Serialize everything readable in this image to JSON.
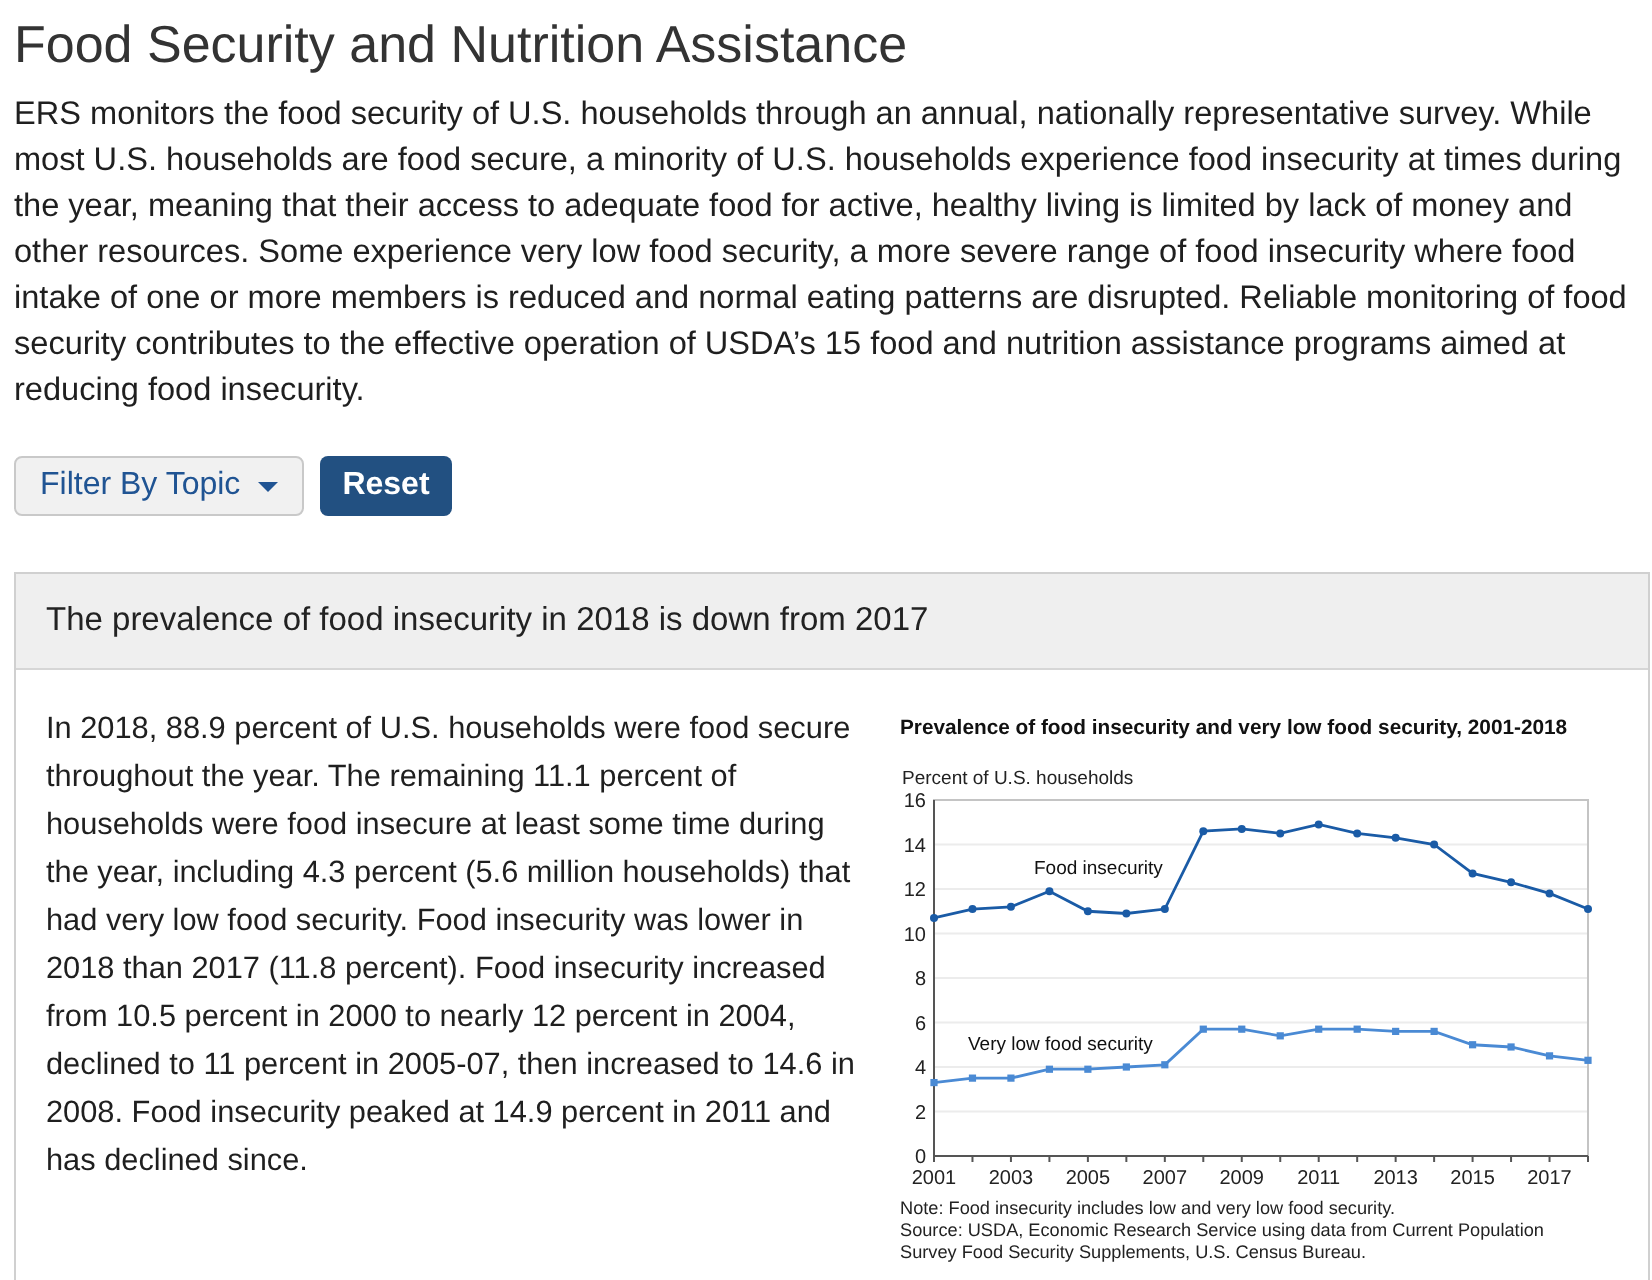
{
  "page": {
    "title": "Food Security and Nutrition Assistance",
    "intro": "ERS monitors the food security of U.S. households through an annual, nationally representative survey. While most U.S. households are food secure, a minority of U.S. households experience food insecurity at times during the year, meaning that their access to adequate food for active, healthy living is limited by lack of money and other resources. Some experience very low food security, a more severe range of food insecurity where food intake of one or more members is reduced and normal eating patterns are disrupted. Reliable monitoring of food security contributes to the effective operation of USDA’s 15 food and nutrition assistance programs aimed at reducing food insecurity."
  },
  "filters": [
    {
      "kind": "dropdown",
      "label": "Filter By Topic"
    },
    {
      "kind": "primary",
      "label": "Reset"
    }
  ],
  "card": {
    "heading": "The prevalence of food insecurity in 2018 is down from 2017",
    "body": "In 2018, 88.9 percent of U.S. households were food secure throughout the year. The remaining 11.1 percent of households were food insecure at least some time during the year, including 4.3 percent (5.6 million households) that had very low food security. Food insecurity was lower in 2018 than 2017 (11.8 percent). Food insecurity increased from 10.5 percent in 2000 to nearly 12 percent in 2004, declined to 11 percent in 2005-07, then increased to 14.6 in 2008. Food insecurity peaked at 14.9 percent in 2011 and has declined since.",
    "chart": {
      "chart_data": {
        "type": "line",
        "title": "Prevalence of food insecurity and very low food security, 2001-2018",
        "ylabel": "Percent of U.S. households",
        "x": [
          2001,
          2002,
          2003,
          2004,
          2005,
          2006,
          2007,
          2008,
          2009,
          2010,
          2011,
          2012,
          2013,
          2014,
          2015,
          2016,
          2017,
          2018
        ],
        "series": [
          {
            "name": "Food insecurity",
            "color": "#1a5ba6",
            "marker": "circle",
            "values": [
              10.7,
              11.1,
              11.2,
              11.9,
              11.0,
              10.9,
              11.1,
              14.6,
              14.7,
              14.5,
              14.9,
              14.5,
              14.3,
              14.0,
              12.7,
              12.3,
              11.8,
              11.1
            ]
          },
          {
            "name": "Very low food security",
            "color": "#4a8ad4",
            "marker": "square",
            "values": [
              3.3,
              3.5,
              3.5,
              3.9,
              3.9,
              4.0,
              4.1,
              5.7,
              5.7,
              5.4,
              5.7,
              5.7,
              5.6,
              5.6,
              5.0,
              4.9,
              4.5,
              4.3
            ]
          }
        ],
        "xlim": [
          2001,
          2018
        ],
        "ylim": [
          0,
          16
        ],
        "xticks": [
          2001,
          2003,
          2005,
          2007,
          2009,
          2011,
          2013,
          2015,
          2017
        ],
        "yticks": [
          0,
          2,
          4,
          6,
          8,
          10,
          12,
          14,
          16
        ],
        "grid": true
      },
      "notes": [
        "Note: Food insecurity includes low and very low food security.",
        "Source: USDA, Economic Research Service using data from Current Population Survey Food Security Supplements, U.S. Census Bureau."
      ]
    }
  }
}
